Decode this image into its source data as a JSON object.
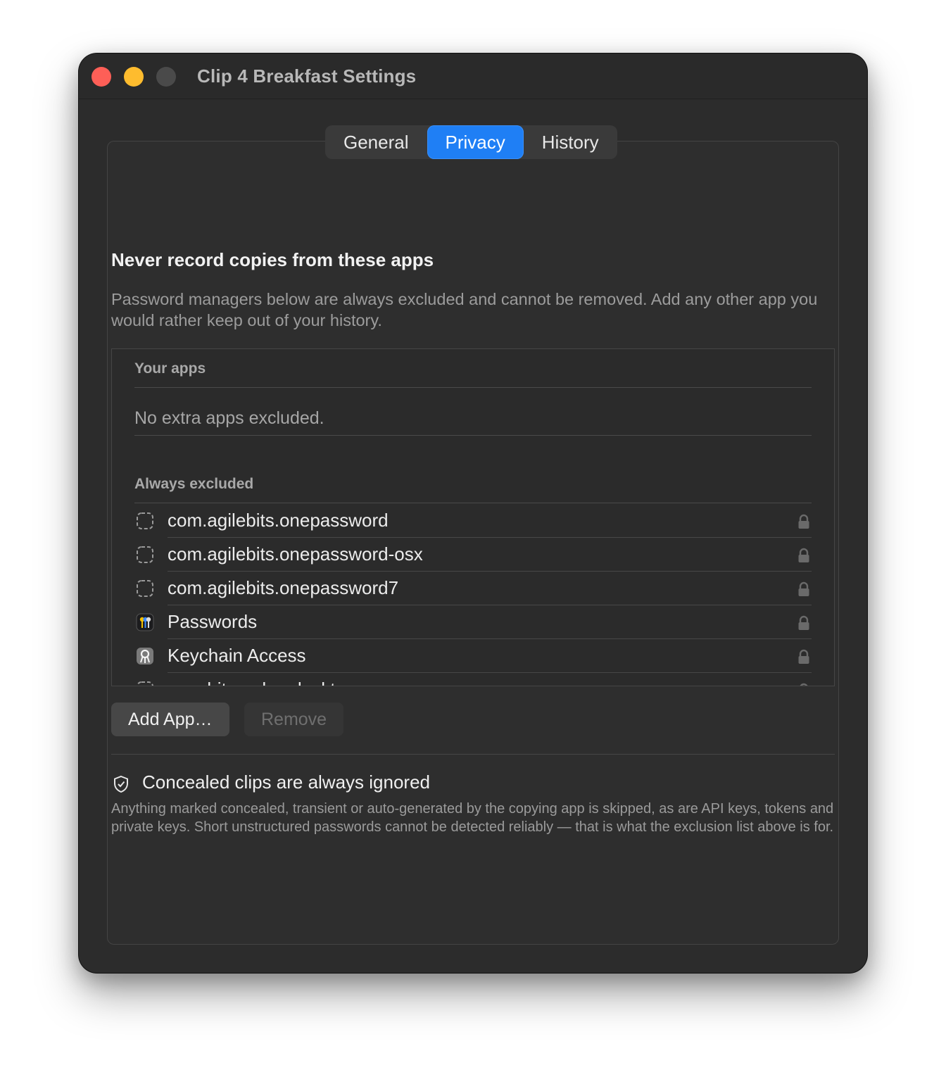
{
  "window": {
    "title": "Clip 4 Breakfast Settings",
    "traffic_lights": {
      "close_color": "#fe5f57",
      "minimize_color": "#febc2e",
      "zoom_color": "#4a4a4a"
    }
  },
  "tabs": [
    {
      "label": "General",
      "selected": false
    },
    {
      "label": "Privacy",
      "selected": true
    },
    {
      "label": "History",
      "selected": false
    }
  ],
  "accent_color": "#1f7ff5",
  "privacy": {
    "heading": "Never record copies from these apps",
    "description": "Password managers below are always excluded and cannot be removed. Add any other app you would rather keep out of your history.",
    "your_apps": {
      "header": "Your apps",
      "empty_text": "No extra apps excluded."
    },
    "always_excluded": {
      "header": "Always excluded",
      "items": [
        {
          "label": "com.agilebits.onepassword",
          "icon": "placeholder-app-icon"
        },
        {
          "label": "com.agilebits.onepassword-osx",
          "icon": "placeholder-app-icon"
        },
        {
          "label": "com.agilebits.onepassword7",
          "icon": "placeholder-app-icon"
        },
        {
          "label": "Passwords",
          "icon": "passwords-app-icon"
        },
        {
          "label": "Keychain Access",
          "icon": "keychain-access-icon"
        },
        {
          "label": "com.bitwarden.desktop",
          "icon": "placeholder-app-icon"
        }
      ],
      "lock_icon": "lock-icon"
    },
    "buttons": {
      "add_label": "Add App…",
      "remove_label": "Remove"
    },
    "concealed": {
      "icon": "shield-check-icon",
      "title": "Concealed clips are always ignored",
      "description": "Anything marked concealed, transient or auto-generated by the copying app is skipped, as are API keys, tokens and private keys. Short unstructured passwords cannot be detected reliably — that is what the exclusion list above is for."
    }
  }
}
